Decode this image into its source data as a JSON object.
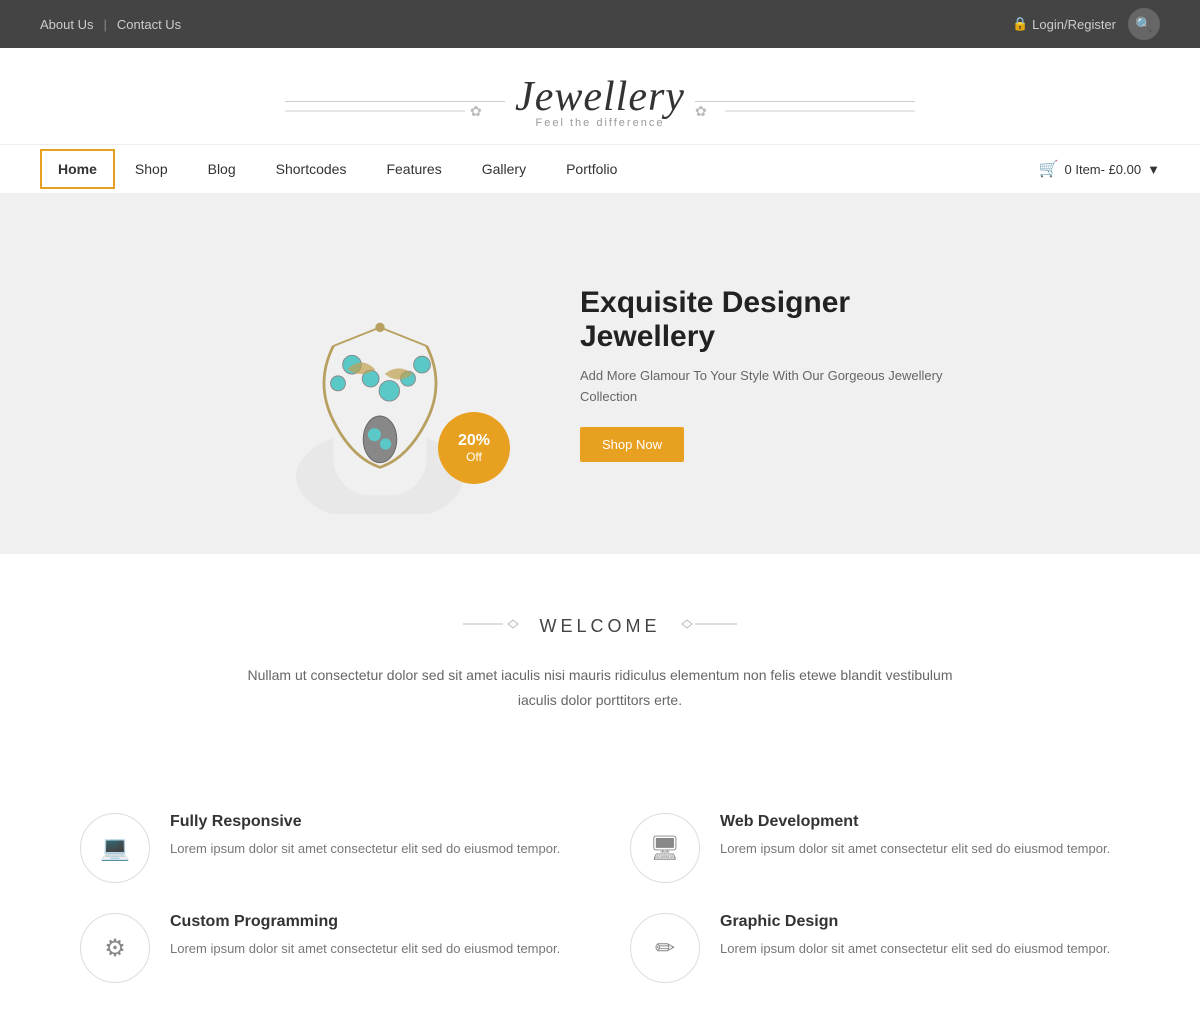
{
  "topbar": {
    "about_label": "About Us",
    "contact_label": "Contact Us",
    "login_label": "Login/Register",
    "search_icon": "🔍"
  },
  "logo": {
    "brand_name": "Jewellery",
    "tagline": "Feel the difference"
  },
  "nav": {
    "items": [
      {
        "label": "Home",
        "active": true
      },
      {
        "label": "Shop",
        "active": false
      },
      {
        "label": "Blog",
        "active": false
      },
      {
        "label": "Shortcodes",
        "active": false
      },
      {
        "label": "Features",
        "active": false
      },
      {
        "label": "Gallery",
        "active": false
      },
      {
        "label": "Portfolio",
        "active": false
      }
    ],
    "cart_label": "0 Item- £0.00"
  },
  "hero": {
    "discount_percent": "20%",
    "discount_label": "Off",
    "title_bold": "Exquisite",
    "title_rest": " Designer Jewellery",
    "subtitle": "Add More Glamour To Your Style With Our Gorgeous Jewellery Collection",
    "cta_label": "Shop Now"
  },
  "welcome": {
    "title": "WELCOME",
    "body": "Nullam ut consectetur dolor sed sit amet iaculis nisi mauris ridiculus elementum non felis etewe blandit vestibulum iaculis dolor porttitors erte."
  },
  "features": [
    {
      "icon": "💻",
      "title": "Fully Responsive",
      "desc": "Lorem ipsum dolor sit amet consectetur elit sed do eiusmod tempor."
    },
    {
      "icon": "🖥",
      "title": "Web Development",
      "desc": "Lorem ipsum dolor sit amet consectetur elit sed do eiusmod tempor."
    },
    {
      "icon": "⚙",
      "title": "Custom Programming",
      "desc": "Lorem ipsum dolor sit amet consectetur elit sed do eiusmod tempor."
    },
    {
      "icon": "✏",
      "title": "Graphic Design",
      "desc": "Lorem ipsum dolor sit amet consectetur elit sed do eiusmod tempor."
    }
  ]
}
